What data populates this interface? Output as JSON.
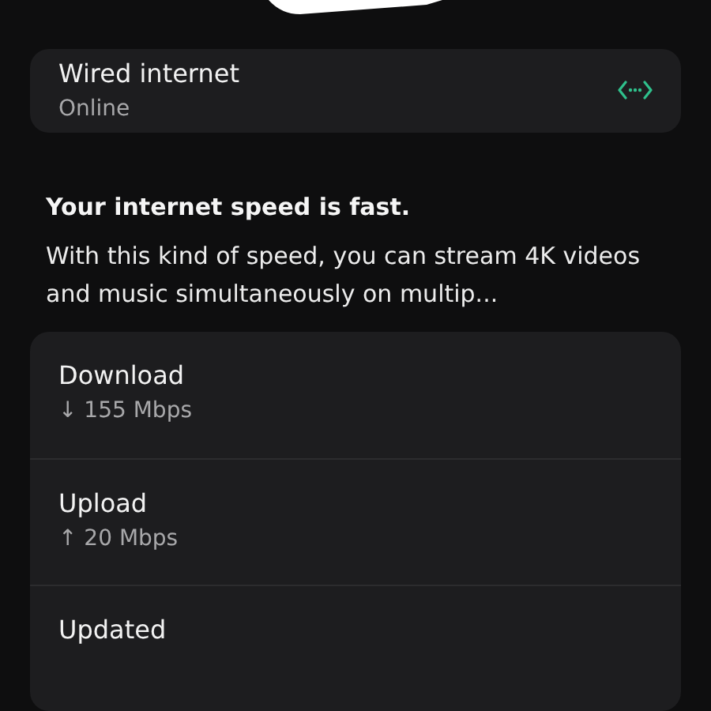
{
  "connection": {
    "title": "Wired internet",
    "status": "Online"
  },
  "summary": {
    "heading": "Your internet speed is fast.",
    "text": "With this kind of speed, you can stream 4K videos and music simultaneously on multip..."
  },
  "stats": [
    {
      "label": "Download",
      "value": "↓ 155 Mbps"
    },
    {
      "label": "Upload",
      "value": "↑ 20 Mbps"
    },
    {
      "label": "Updated"
    }
  ]
}
